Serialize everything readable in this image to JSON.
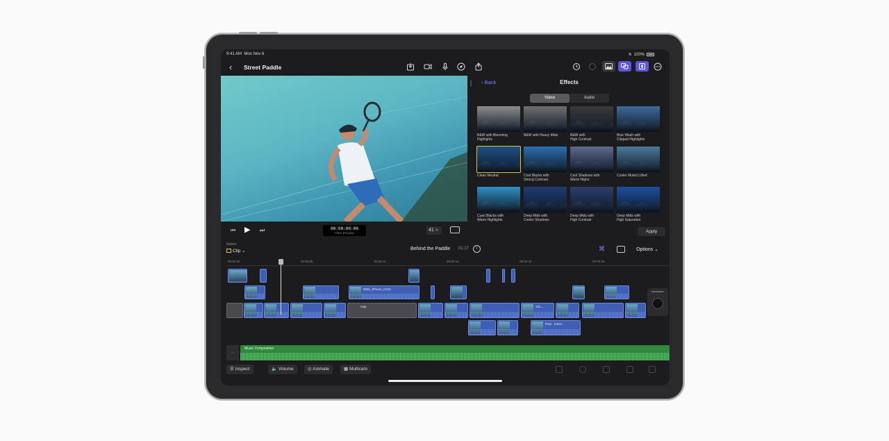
{
  "status": {
    "time": "9:41 AM",
    "date": "Mon Nov 6",
    "battery": "100%"
  },
  "toolbar": {
    "title": "Street Paddle"
  },
  "viewer": {
    "timecode": "00:00:00:00",
    "timecode_label": "Filter Preview",
    "zoom": "41",
    "zoom_unit": "%"
  },
  "effects": {
    "back": "Back",
    "title": "Effects",
    "tabs": [
      "Video",
      "Audio"
    ],
    "selected_tab": "Video",
    "items": [
      {
        "label": "B&W with Blooming\nHighlights",
        "color": "#8c8c8c"
      },
      {
        "label": "B&W with Heavy Mids",
        "color": "#6f6f6f"
      },
      {
        "label": "B&W with\nHigh Contrast",
        "color": "#3a3a3a"
      },
      {
        "label": "Blue Wash with\nClipped Highlights",
        "color": "#3e6a98"
      },
      {
        "label": "Clean Neutral",
        "color": "#1f4f86"
      },
      {
        "label": "Cool Blacks with\nStrong Contrast",
        "color": "#2b6fb1"
      },
      {
        "label": "Cool Shadows with\nWarm Highs",
        "color": "#5d6a8f"
      },
      {
        "label": "Cooler Muted Lifted",
        "color": "#4b7a98"
      },
      {
        "label": "Cyan Blacks with\nWarm Highlights",
        "color": "#2f8fc2"
      },
      {
        "label": "Deep Mids with\nCooler Shadows",
        "color": "#1f3b73"
      },
      {
        "label": "Deep Mids with\nHigh Contrast",
        "color": "#2c3f6b"
      },
      {
        "label": "Deep Mids with\nHigh Saturation",
        "color": "#1c4fa0"
      }
    ],
    "selected_index": 4,
    "apply": "Apply"
  },
  "timeline": {
    "select_label": "Select",
    "mode": "Clip",
    "project": "Behind the Paddle",
    "duration": "01:17",
    "options": "Options",
    "ruler": [
      "00:00:00",
      "00:00:05",
      "00:00:10",
      "00:00:15",
      "00:00:20",
      "00:00:25"
    ],
    "clip_label_a": "0001_iPhone_C012",
    "clip_label_gap": "Gap",
    "clip_label_b": "231...",
    "clip_label_ipad": "iPad - Interv...",
    "music_label": "Music Composition"
  },
  "bottom": {
    "inspect": "Inspect",
    "volume": "Volume",
    "animate": "Animate",
    "multicam": "Multicam"
  },
  "colors": {
    "accent": "#7f86ff",
    "selection": "#e3c23b",
    "clip_blue": "#3e5fb4",
    "music_green": "#2f8a3e"
  }
}
